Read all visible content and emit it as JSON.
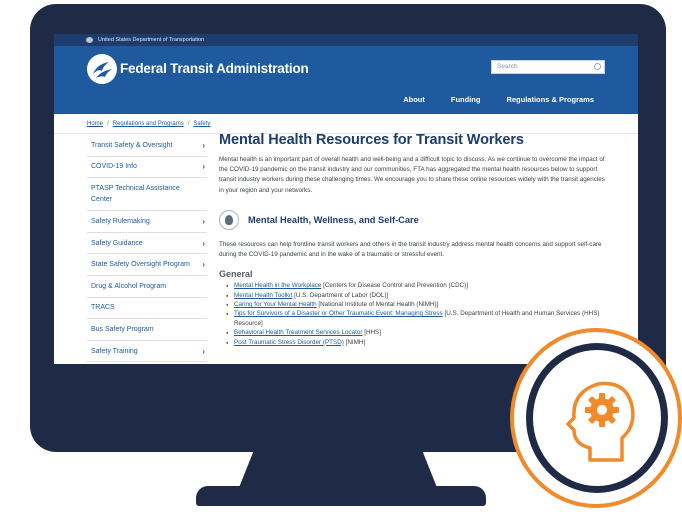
{
  "gov_banner": {
    "text": "United States Department of Transportation"
  },
  "header": {
    "site_name": "Federal Transit Administration",
    "search_placeholder": "Search",
    "nav": [
      "About",
      "Funding",
      "Regulations & Programs"
    ]
  },
  "breadcrumb": [
    "Home",
    "Regulations and Programs",
    "Safety"
  ],
  "sidebar": {
    "items": [
      {
        "label": "Transit Safety & Oversight",
        "chevron": true
      },
      {
        "label": "COVID-19 Info",
        "chevron": true
      },
      {
        "label": "PTASP Technical Assistance Center",
        "chevron": false
      },
      {
        "label": "Safety Rulemaking",
        "chevron": true
      },
      {
        "label": "Safety Guidance",
        "chevron": true
      },
      {
        "label": "State Safety Oversight Program",
        "chevron": true
      },
      {
        "label": "Drug & Alcohol Program",
        "chevron": false
      },
      {
        "label": "TRACS",
        "chevron": false
      },
      {
        "label": "Bus Safety Program",
        "chevron": false
      },
      {
        "label": "Safety Training",
        "chevron": true
      }
    ]
  },
  "main": {
    "title": "Mental Health Resources for Transit Workers",
    "intro": "Mental health is an important part of overall health and well-being and a difficult topic to discuss. As we continue to overcome the impact of the COVID-19 pandemic on the transit industry and our communities, FTA has aggregated the mental health resources below to support transit industry workers during these challenging times. We encourage you to share these online resources widely with the transit agencies in your region and your networks.",
    "section_title": "Mental Health, Wellness, and Self-Care",
    "section_text": "These resources can help frontline transit workers and others in the transit industry address mental health concerns and support self-care during the COVID-19 pandemic and in the wake of a traumatic or stressful event.",
    "general_heading": "General",
    "resources": [
      {
        "link": "Mental Health in the Workplace",
        "source": " [Centers for Disease Control and Prevention (CDC)]"
      },
      {
        "link": "Mental Health Toolkit",
        "source": " [U.S. Department of Labor (DOL)]"
      },
      {
        "link": "Caring for Your Mental Health",
        "source": " [National Institute of Mental Health (NIMH)]"
      },
      {
        "link": "Tips for Survivors of a Disaster or Other Traumatic Event: Managing Stress",
        "source": " [U.S. Department of Health and Human Services (HHS) Resource]"
      },
      {
        "link": "Behavioral Health Treatment Services Locator",
        "source": " [HHS]"
      },
      {
        "link": "Post Traumatic Stress Disorder (PTSD)",
        "source": " [NIMH]"
      }
    ]
  },
  "colors": {
    "monitor": "#1f2b46",
    "header_blue": "#1e5a9d",
    "title_navy": "#1c3d6e",
    "badge_orange": "#f08a2a"
  },
  "icons": {
    "badge": "head-with-gear-icon",
    "section": "wellness-icon",
    "logo": "fta-logo-icon",
    "search": "search-icon"
  }
}
